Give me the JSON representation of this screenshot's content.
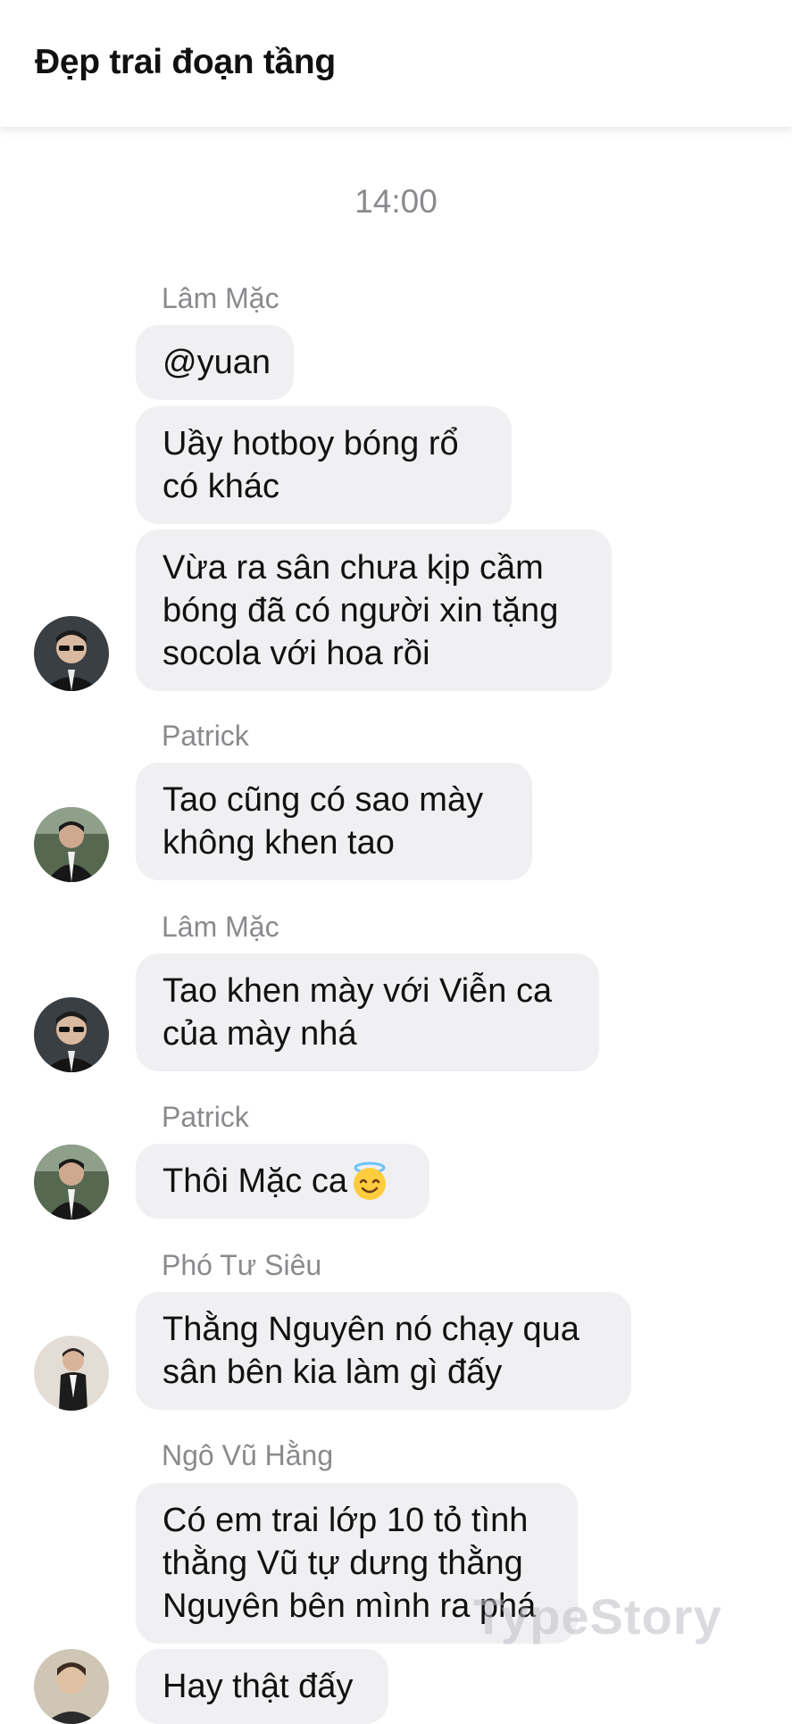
{
  "header": {
    "title": "Đẹp trai đoạn tầng"
  },
  "chat": {
    "time": "14:00",
    "groups": [
      {
        "sender": "Lâm Mặc",
        "messages": [
          "@yuan",
          "Uầy hotboy bóng rổ\ncó khác",
          "Vừa ra sân chưa kịp cầm\nbóng đã có người xin tặng\nsocola với hoa rồi"
        ]
      },
      {
        "sender": "Patrick",
        "messages": [
          "Tao cũng có sao mày\nkhông khen tao"
        ]
      },
      {
        "sender": "Lâm Mặc",
        "messages": [
          "Tao khen mày với Viễn ca\ncủa mày nhá"
        ]
      },
      {
        "sender": "Patrick",
        "messages": [
          "Thôi Mặc ca"
        ],
        "emoji": "smiling-face-with-halo-icon"
      },
      {
        "sender": "Phó Tư Siêu",
        "messages": [
          "Thằng Nguyên nó chạy qua\nsân bên kia làm gì đấy"
        ]
      },
      {
        "sender": "Ngô Vũ Hằng",
        "messages": [
          "Có em trai lớp 10 tỏ tình\nthằng Vũ tự dưng thằng\nNguyên bên mình ra phá",
          "Hay thật đấy"
        ]
      }
    ]
  },
  "watermark": "TypeStory",
  "colors": {
    "bubble_bg": "#f0f0f2",
    "secondary_text": "#8a8a8e",
    "primary_text": "#111111",
    "background": "#ffffff"
  }
}
